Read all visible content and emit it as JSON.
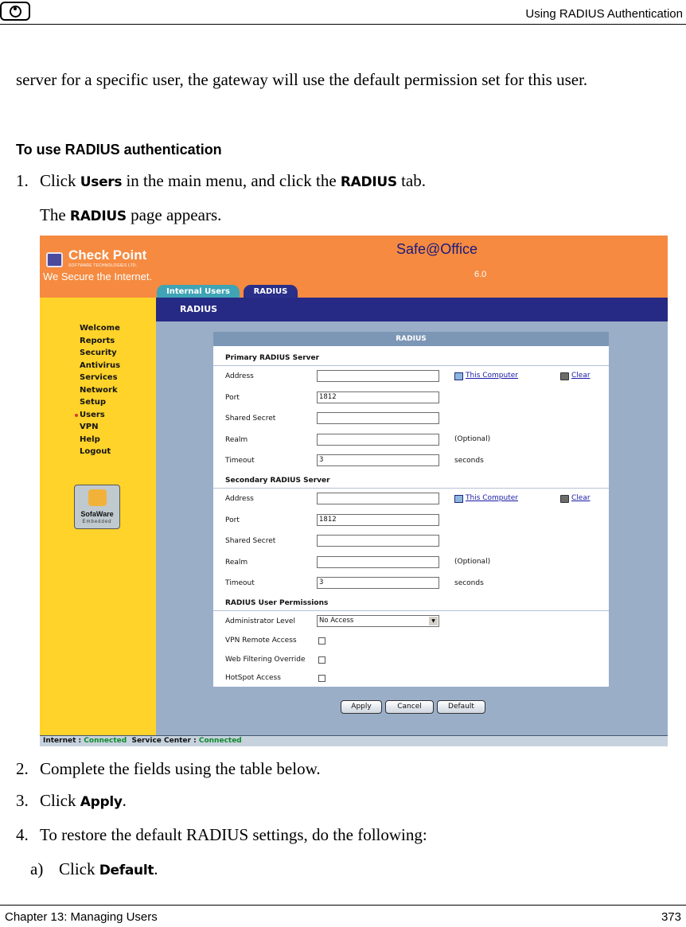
{
  "header": {
    "title": "Using RADIUS Authentication"
  },
  "footer": {
    "chapter": "Chapter 13: Managing Users",
    "page": "373"
  },
  "intro": "server for a specific user, the gateway will use the default permission set for this user.",
  "section_heading": "To use RADIUS authentication",
  "steps": [
    {
      "num": "1.",
      "before": "Click ",
      "ui1": "Users",
      "middle": " in the main menu, and click the ",
      "ui2": "RADIUS",
      "after": " tab."
    },
    {
      "before": "The ",
      "ui": "RADIUS",
      "after": " page appears."
    },
    {
      "num": "2.",
      "text": "Complete the fields using the table below."
    },
    {
      "num": "3.",
      "before": "Click ",
      "ui": "Apply",
      "after": "."
    },
    {
      "num": "4.",
      "text": "To restore the default RADIUS settings, do the following:"
    },
    {
      "num": "a)",
      "before": "Click ",
      "ui": "Default",
      "after": "."
    }
  ],
  "screenshot": {
    "logo_name": "Check Point",
    "logo_sub": "SOFTWARE TECHNOLOGIES LTD.",
    "logo_tagline": "We Secure the Internet.",
    "product": "Safe@Office",
    "version": "6.0",
    "tabs": [
      "Internal Users",
      "RADIUS"
    ],
    "page_title": "RADIUS",
    "menu": [
      "Welcome",
      "Reports",
      "Security",
      "Antivirus",
      "Services",
      "Network",
      "Setup",
      "Users",
      "VPN",
      "Help",
      "Logout"
    ],
    "active_menu": "Users",
    "sofaware_name": "SofaWare",
    "sofaware_sub": "Embedded",
    "panel_title": "RADIUS",
    "primary": {
      "heading": "Primary RADIUS Server",
      "labels": [
        "Address",
        "Port",
        "Shared Secret",
        "Realm",
        "Timeout"
      ],
      "port": "1812",
      "timeout": "3",
      "this_computer": "This Computer",
      "clear": "Clear",
      "optional": "(Optional)",
      "seconds": "seconds"
    },
    "secondary": {
      "heading": "Secondary RADIUS Server",
      "labels": [
        "Address",
        "Port",
        "Shared Secret",
        "Realm",
        "Timeout"
      ],
      "port": "1812",
      "timeout": "3",
      "this_computer": "This Computer",
      "clear": "Clear",
      "optional": "(Optional)",
      "seconds": "seconds"
    },
    "permissions": {
      "heading": "RADIUS User Permissions",
      "labels": [
        "Administrator Level",
        "VPN Remote Access",
        "Web Filtering Override",
        "HotSpot Access"
      ],
      "admin_level": "No Access"
    },
    "buttons": [
      "Apply",
      "Cancel",
      "Default"
    ],
    "status": {
      "internet_label": "Internet :",
      "internet_value": "Connected",
      "service_label": "Service Center :",
      "service_value": "Connected"
    }
  }
}
